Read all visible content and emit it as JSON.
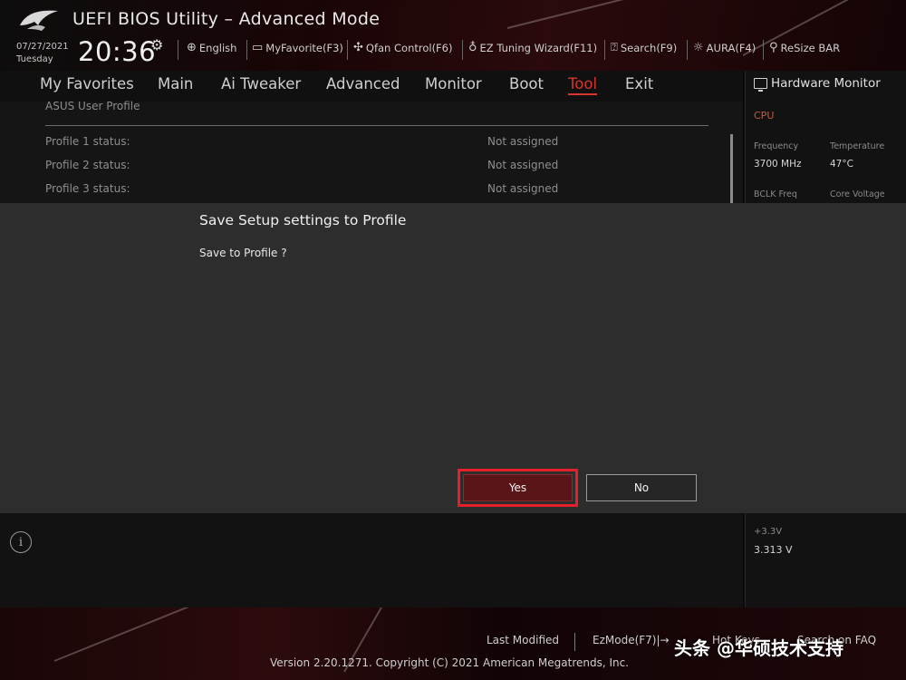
{
  "header": {
    "title": "UEFI BIOS Utility – Advanced Mode",
    "date": "07/27/2021",
    "day": "Tuesday",
    "time": "20:36",
    "items": [
      {
        "icon": "globe-icon",
        "label": "English"
      },
      {
        "icon": "star-folder-icon",
        "label": "MyFavorite(F3)"
      },
      {
        "icon": "fan-icon",
        "label": "Qfan Control(F6)"
      },
      {
        "icon": "bulb-icon",
        "label": "EZ Tuning Wizard(F11)"
      },
      {
        "icon": "question-icon",
        "label": "Search(F9)"
      },
      {
        "icon": "aura-icon",
        "label": "AURA(F4)"
      },
      {
        "icon": "rebar-icon",
        "label": "ReSize BAR"
      }
    ]
  },
  "tabs": [
    "My Favorites",
    "Main",
    "Ai Tweaker",
    "Advanced",
    "Monitor",
    "Boot",
    "Tool",
    "Exit"
  ],
  "active_tab": "Tool",
  "content": {
    "section": "ASUS User Profile",
    "rows": [
      {
        "label": "Profile 1 status:",
        "value": "Not assigned"
      },
      {
        "label": "Profile 2 status:",
        "value": "Not assigned"
      },
      {
        "label": "Profile 3 status:",
        "value": "Not assigned"
      }
    ]
  },
  "hardware_monitor": {
    "title": "Hardware Monitor",
    "cpu_label": "CPU",
    "frequency_label": "Frequency",
    "frequency_value": "3700 MHz",
    "temperature_label": "Temperature",
    "temperature_value": "47°C",
    "bclk_label": "BCLK Freq",
    "core_voltage_label": "Core Voltage",
    "v33_label": "+3.3V",
    "v33_value": "3.313 V"
  },
  "dialog": {
    "title": "Save Setup settings to Profile",
    "message": "Save to Profile ?",
    "yes_label": "Yes",
    "no_label": "No"
  },
  "footer": {
    "last_modified": "Last Modified",
    "ezmode": "EzMode(F7)|→",
    "hot_keys": "Hot Keys",
    "search_faq": "Search on FAQ",
    "version": "Version 2.20.1271. Copyright (C) 2021 American Megatrends, Inc.",
    "watermark": "头条 @华硕技术支持"
  },
  "colors": {
    "accent": "#d9342b",
    "focus_ring": "#e4202a",
    "dialog_bg": "#2d2d2d"
  }
}
